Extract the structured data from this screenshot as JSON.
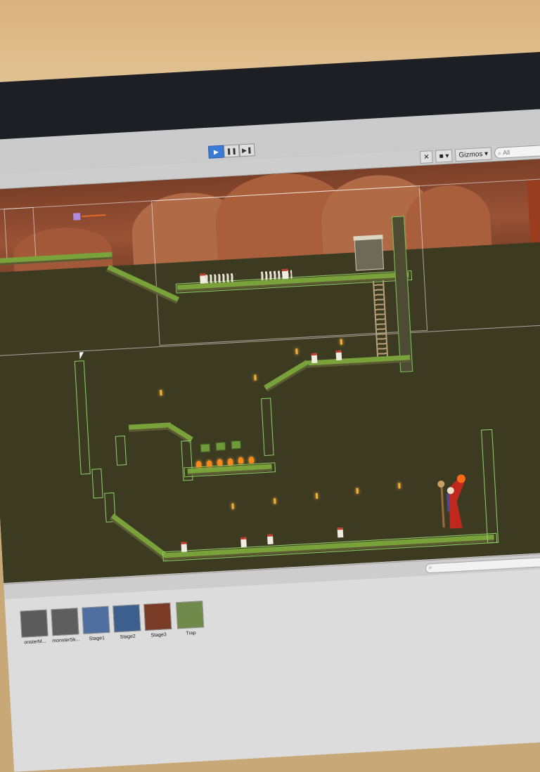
{
  "toolbar": {
    "play_icon": "play-icon",
    "pause_icon": "pause-icon",
    "step_icon": "step-icon",
    "play_glyph": "▶",
    "pause_glyph": "❚❚",
    "step_glyph": "▶❚"
  },
  "scene_header": {
    "tools_glyph": "✕",
    "camera_glyph": "■",
    "gizmos_label": "Gizmos",
    "gizmos_arrow": "▾",
    "search_placeholder": "All",
    "search_glyph": "⌕"
  },
  "project_panel": {
    "search_glyph": "⌕",
    "assets": [
      {
        "label": "onsterM...",
        "color": "#5b5b5b"
      },
      {
        "label": "monsterSk...",
        "color": "#5e5e5e"
      },
      {
        "label": "Stage1",
        "color": "#4f6fa0"
      },
      {
        "label": "Stage2",
        "color": "#3d5f8e"
      },
      {
        "label": "Stage3",
        "color": "#7a3b26"
      },
      {
        "label": "Trap",
        "color": "#6f8a4a"
      }
    ]
  },
  "colors": {
    "accent": "#3b7bd8",
    "grass": "#79a23a",
    "collider": "#8fd36b",
    "cave": "#3c3a22",
    "rock": "#9a5236"
  }
}
